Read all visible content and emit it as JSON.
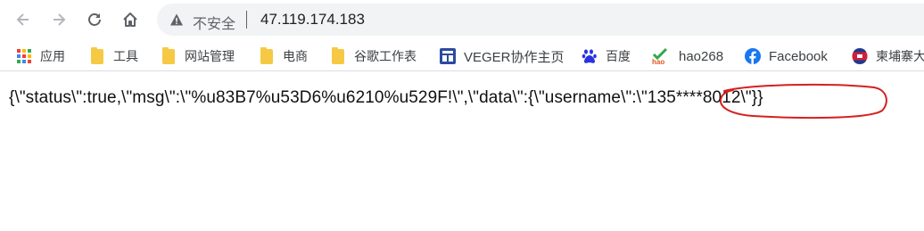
{
  "browser": {
    "security_text": "不安全",
    "url": "47.119.174.183"
  },
  "bookmarks": [
    {
      "label": "应用",
      "icon": "apps-grid-icon"
    },
    {
      "label": "工具",
      "icon": "folder-icon"
    },
    {
      "label": "网站管理",
      "icon": "folder-icon"
    },
    {
      "label": "电商",
      "icon": "folder-icon"
    },
    {
      "label": "谷歌工作表",
      "icon": "folder-icon"
    },
    {
      "label": "VEGER协作主页",
      "icon": "veger-icon"
    },
    {
      "label": "百度",
      "icon": "baidu-paw-icon"
    },
    {
      "label": "hao268",
      "icon": "hao268-icon"
    },
    {
      "label": "Facebook",
      "icon": "facebook-icon"
    },
    {
      "label": "柬埔寨大",
      "icon": "cambodia-flag-icon"
    }
  ],
  "page": {
    "json_text": "{\\\"status\\\":true,\\\"msg\\\":\\\"%u83B7%u53D6%u6210%u529F!\\\",\\\"data\\\":{\\\"username\\\":\\\"135****8012\\\"}}"
  },
  "colors": {
    "annotation": "#d62020",
    "folder": "#f6c944",
    "omnibox_bg": "#f1f3f4"
  }
}
